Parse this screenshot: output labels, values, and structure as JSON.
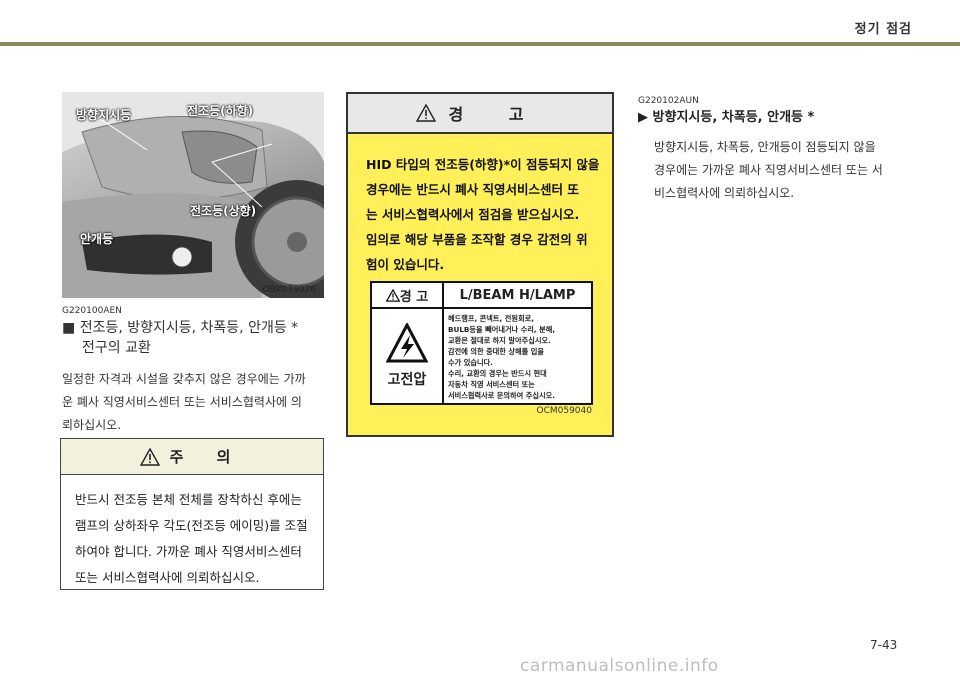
{
  "header": {
    "title": "정기 점검"
  },
  "photo": {
    "callouts": [
      "방향지시등",
      "전조등(하향)",
      "전조등(상향)",
      "안개등"
    ],
    "code": "OBK079026"
  },
  "left_section": {
    "code": "G220100AEN",
    "bullet": "■",
    "title_line1": "전조등, 방향지시등, 차폭등, 안개등 *",
    "title_line2": "전구의 교환",
    "body": [
      "일정한 자격과 시설을 갖추지 않은 경우에는 가까",
      "운 폐사 직영서비스센터 또는 서비스협력사에 의",
      "뢰하십시오."
    ]
  },
  "caution": {
    "title": "주 의",
    "lines": [
      "반드시 전조등 본체 전체를 장착하신 후에는",
      "램프의 상하좌우 각도(전조등 에이밍)를 조절",
      "하여야 합니다. 가까운 폐사 직영서비스센터",
      "또는 서비스협력사에 의뢰하십시오."
    ]
  },
  "warning": {
    "title": "경 고",
    "lines": [
      "HID 타입의 전조등(하향)*이 점등되지 않을",
      "경우에는 반드시 폐사 직영서비스센터 또",
      "는 서비스협력사에서 점검을 받으십시오.",
      "임의로 해당 부품을 조작할 경우 감전의 위",
      "험이 있습니다."
    ],
    "label": {
      "head_left": "경 고",
      "head_right": "L/BEAM H/LAMP",
      "high_voltage": "고전압",
      "text": [
        "헤드램프, 콘넥트, 전원회로,",
        "BULB등을 빼어내거나 수리, 분해,",
        "교환은 절대로 하지 말아주십시오.",
        "감전에 의한 중대한 상해를 입을",
        "수가 있습니다.",
        "수리, 교환의 경우는 반드시 현대",
        "자동차 직영 서비스센터 또는",
        "서비스협력사로 문의하여 주십시오."
      ]
    },
    "code": "OCM059040"
  },
  "right_section": {
    "code": "G220102AUN",
    "title": "▶ 방향지시등, 차폭등, 안개등 *",
    "body": [
      "방향지시등, 차폭등, 안개등이 점등되지 않을",
      "경우에는 가까운 폐사 직영서비스센터 또는 서",
      "비스협력사에 의뢰하십시오."
    ]
  },
  "page_number": "7-43",
  "watermark": "carmanualsonline.info"
}
